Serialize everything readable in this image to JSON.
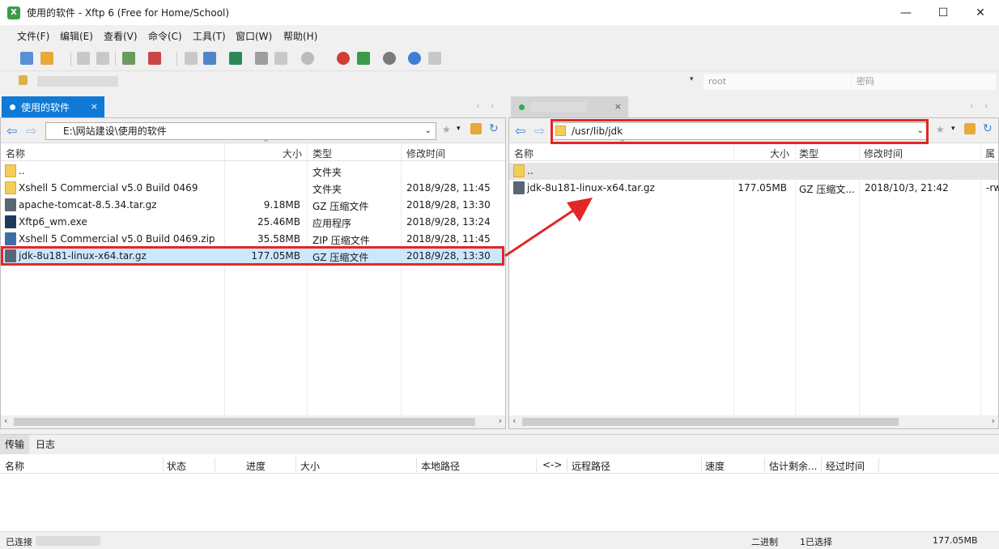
{
  "window": {
    "title": "使用的软件 - Xftp 6 (Free for Home/School)",
    "minimize": "—",
    "maximize": "☐",
    "close": "✕"
  },
  "menu": [
    "文件(F)",
    "编辑(E)",
    "查看(V)",
    "命令(C)",
    "工具(T)",
    "窗口(W)",
    "帮助(H)"
  ],
  "address_bar": {
    "user_placeholder": "root",
    "password_placeholder": "密码"
  },
  "left_tab": {
    "label": "使用的软件",
    "close": "×"
  },
  "right_tab": {
    "close": "×"
  },
  "left_pane": {
    "path": "E:\\网站建设\\使用的软件",
    "columns": [
      "名称",
      "大小",
      "类型",
      "修改时间"
    ],
    "rows": [
      {
        "name": "..",
        "size": "",
        "type": "文件夹",
        "modified": "",
        "icon": "folder-icon"
      },
      {
        "name": "Xshell 5 Commercial v5.0 Build 0469",
        "size": "",
        "type": "文件夹",
        "modified": "2018/9/28, 11:45",
        "icon": "folder-icon"
      },
      {
        "name": "apache-tomcat-8.5.34.tar.gz",
        "size": "9.18MB",
        "type": "GZ 压缩文件",
        "modified": "2018/9/28, 13:30",
        "icon": "gz-icon"
      },
      {
        "name": "Xftp6_wm.exe",
        "size": "25.46MB",
        "type": "应用程序",
        "modified": "2018/9/28, 13:24",
        "icon": "exe-icon"
      },
      {
        "name": "Xshell 5 Commercial v5.0 Build 0469.zip",
        "size": "35.58MB",
        "type": "ZIP 压缩文件",
        "modified": "2018/9/28, 11:45",
        "icon": "zip-icon"
      },
      {
        "name": "jdk-8u181-linux-x64.tar.gz",
        "size": "177.05MB",
        "type": "GZ 压缩文件",
        "modified": "2018/9/28, 13:30",
        "icon": "gz-icon"
      }
    ]
  },
  "right_pane": {
    "path": "/usr/lib/jdk",
    "columns": [
      "名称",
      "大小",
      "类型",
      "修改时间",
      "属性"
    ],
    "rows": [
      {
        "name": "..",
        "size": "",
        "type": "",
        "modified": "",
        "attr": "",
        "icon": "folder-icon"
      },
      {
        "name": "jdk-8u181-linux-x64.tar.gz",
        "size": "177.05MB",
        "type": "GZ 压缩文...",
        "modified": "2018/10/3, 21:42",
        "attr": "-rw",
        "icon": "gz-icon"
      }
    ]
  },
  "log": {
    "tabs": [
      "传输",
      "日志"
    ],
    "columns": [
      "名称",
      "状态",
      "进度",
      "大小",
      "本地路径",
      "<->",
      "远程路径",
      "速度",
      "估计剩余...",
      "经过时间"
    ]
  },
  "status": {
    "connection": "已连接",
    "mode": "二进制",
    "selection": "1已选择",
    "size": "177.05MB"
  }
}
